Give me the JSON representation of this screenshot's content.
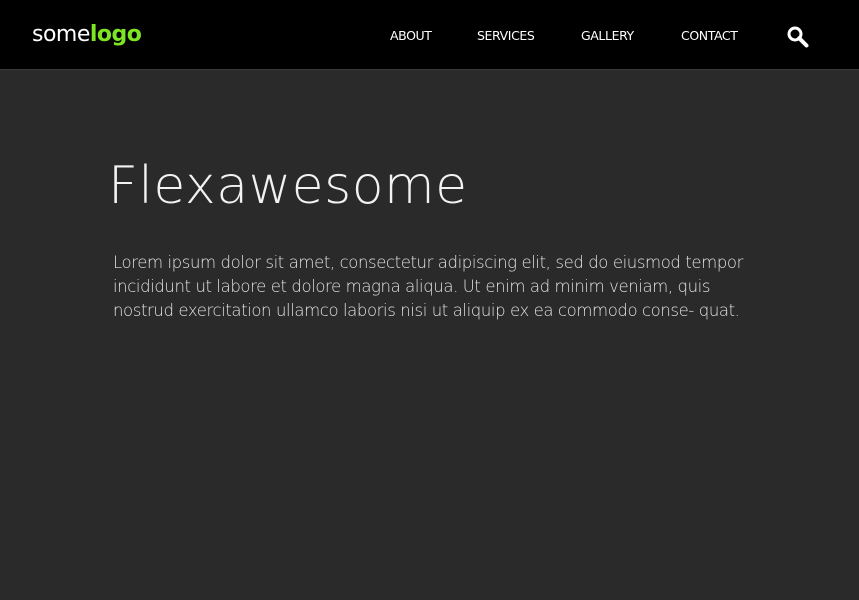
{
  "header": {
    "logo_light": "some",
    "logo_bold": "logo",
    "nav": {
      "about": "ABOUT",
      "services": "SERVICES",
      "gallery": "GALLERY",
      "contact": "CONTACT"
    },
    "search_icon": "search-icon"
  },
  "hero": {
    "title": "Flexawesome",
    "body": "Lorem ipsum dolor sit amet, consectetur adipiscing elit, sed do eiusmod tempor incididunt ut labore et dolore magna aliqua. Ut enim ad minim veniam, quis nostrud exercitation ullamco laboris nisi ut aliquip ex ea commodo conse- quat."
  },
  "colors": {
    "header_bg": "#000000",
    "page_bg": "#2a2a2a",
    "logo_accent": "#7ee522",
    "text": "#ffffff"
  }
}
